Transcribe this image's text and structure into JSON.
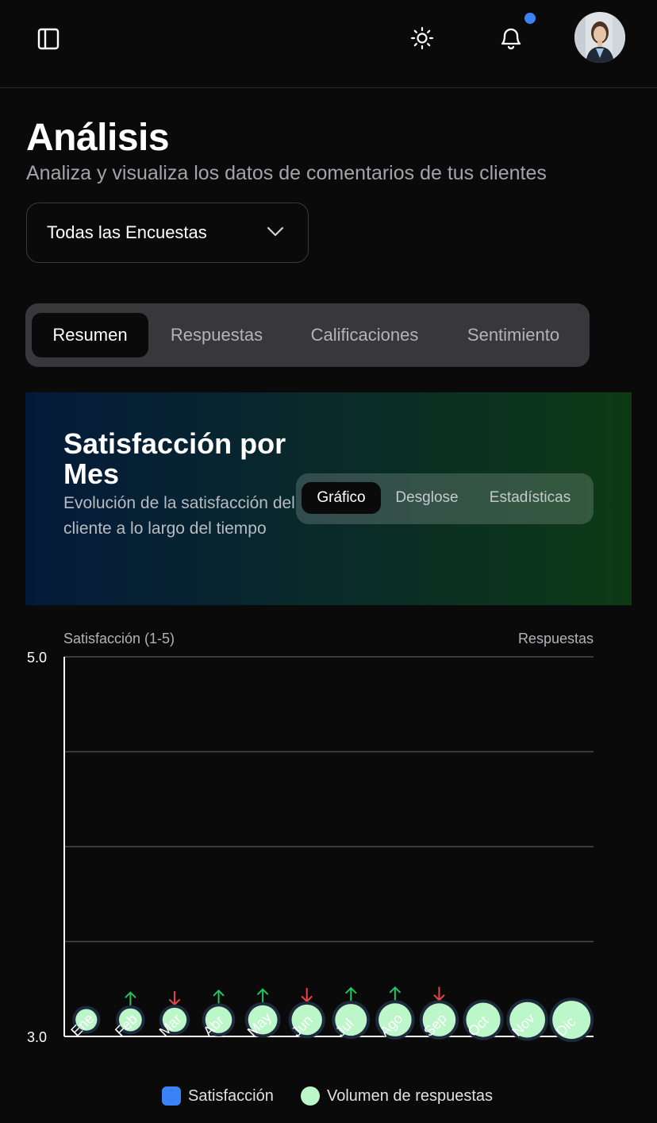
{
  "header": {
    "sidebar_toggle_icon": "sidebar-icon",
    "theme_icon": "sun-icon",
    "notification_icon": "bell-icon",
    "notification_dot_color": "#3b82f6"
  },
  "page": {
    "title": "Análisis",
    "subtitle": "Analiza y visualiza los datos de comentarios de tus clientes"
  },
  "survey_select": {
    "value": "Todas las Encuestas"
  },
  "tabs": [
    {
      "label": "Resumen",
      "active": true
    },
    {
      "label": "Respuestas",
      "active": false
    },
    {
      "label": "Calificaciones",
      "active": false
    },
    {
      "label": "Sentimiento",
      "active": false
    }
  ],
  "card": {
    "title": "Satisfacción por Mes",
    "subtitle": "Evolución de la satisfacción del cliente a lo largo del tiempo",
    "subtabs": [
      {
        "label": "Gráfico",
        "active": true
      },
      {
        "label": "Desglose",
        "active": false
      },
      {
        "label": "Estadísticas",
        "active": false
      }
    ]
  },
  "chart_data": {
    "type": "scatter",
    "y_axis_title": "Satisfacción (1-5)",
    "y2_axis_title": "Respuestas",
    "ylim": [
      3.0,
      5.0
    ],
    "y_ticks": [
      "5.0",
      "3.0"
    ],
    "grid": true,
    "categories": [
      "Ene",
      "Feb",
      "Mar",
      "Abr",
      "May",
      "Jun",
      "Jul",
      "Ago",
      "Sep",
      "Oct",
      "Nov",
      "Dic"
    ],
    "series": [
      {
        "name": "Satisfacción",
        "color": "#3b82f6",
        "values": [
          3.1,
          3.1,
          3.1,
          3.1,
          3.1,
          3.1,
          3.1,
          3.1,
          3.1,
          3.1,
          3.1,
          3.1
        ],
        "trend": [
          "none",
          "up",
          "down",
          "up",
          "up",
          "down",
          "up",
          "up",
          "down",
          "none",
          "none",
          "none"
        ]
      },
      {
        "name": "Volumen de respuestas",
        "color": "#bbf7c8",
        "relative_size": [
          0.35,
          0.4,
          0.45,
          0.55,
          0.65,
          0.7,
          0.75,
          0.8,
          0.8,
          0.85,
          0.9,
          1.0
        ]
      }
    ],
    "trend_colors": {
      "up": "#22c55e",
      "down": "#ef4444"
    }
  },
  "legend": [
    {
      "label": "Satisfacción",
      "color": "#3b82f6"
    },
    {
      "label": "Volumen de respuestas",
      "color": "#bbf7c8"
    }
  ]
}
